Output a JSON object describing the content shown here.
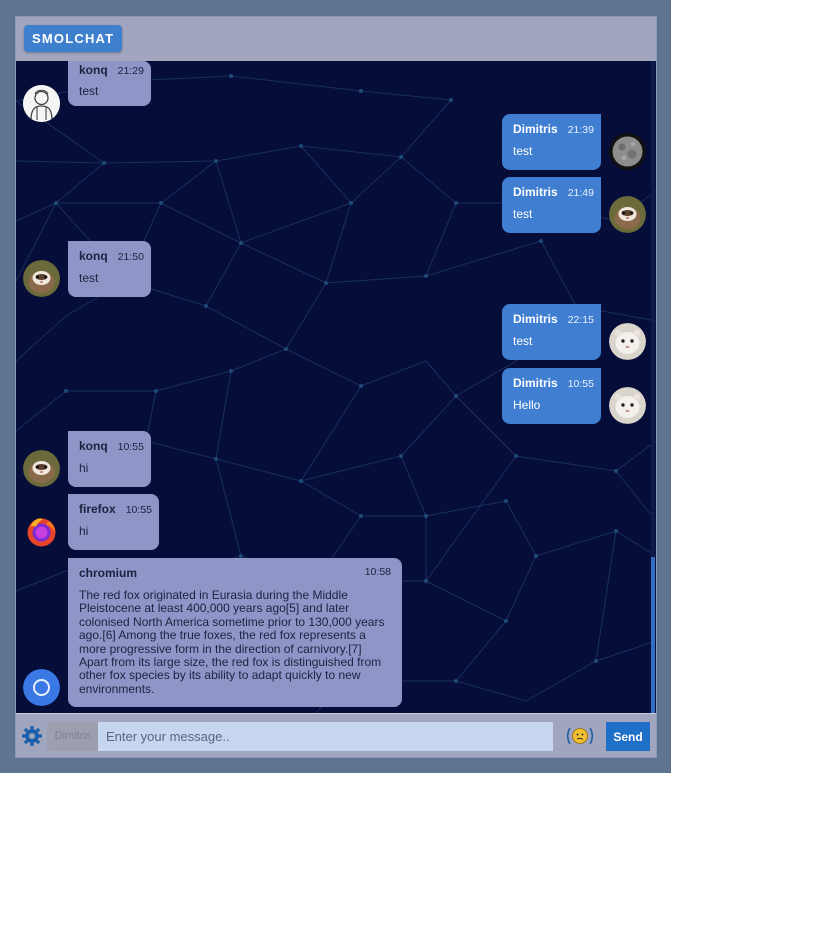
{
  "app": {
    "brand": "SMOLCHAT"
  },
  "messages": [
    {
      "side": "left",
      "name": "konq",
      "time": "21:29",
      "text": "test",
      "avatar": "person-outline-icon"
    },
    {
      "side": "right",
      "name": "Dimitris",
      "time": "21:39",
      "text": "test",
      "avatar": "moon-icon"
    },
    {
      "side": "right",
      "name": "Dimitris",
      "time": "21:49",
      "text": "test",
      "avatar": "ferret-photo-icon"
    },
    {
      "side": "left",
      "name": "konq",
      "time": "21:50",
      "text": "test",
      "avatar": "ferret-photo-icon"
    },
    {
      "side": "right",
      "name": "Dimitris",
      "time": "22:15",
      "text": "test",
      "avatar": "white-ferret-icon"
    },
    {
      "side": "right",
      "name": "Dimitris",
      "time": "10:55",
      "text": "Hello",
      "avatar": "white-ferret-icon"
    },
    {
      "side": "left",
      "name": "konq",
      "time": "10:55",
      "text": "hi",
      "avatar": "ferret-photo-icon"
    },
    {
      "side": "left",
      "name": "firefox",
      "time": "10:55",
      "text": "hi",
      "avatar": "firefox-icon"
    },
    {
      "side": "left",
      "name": "chromium",
      "time": "10:58",
      "text": "The red fox originated in Eurasia during the Middle Pleistocene at least 400,000 years ago[5] and later colonised North America sometime prior to 130,000 years ago.[6] Among the true foxes, the red fox represents a more progressive form in the direction of carnivory.[7] Apart from its large size, the red fox is distinguished from other fox species by its ability to adapt quickly to new environments.",
      "avatar": "chromium-icon"
    }
  ],
  "composer": {
    "username": "Dimitris",
    "placeholder": "Enter your message..",
    "send_label": "Send"
  },
  "colors": {
    "accent": "#3e7fce",
    "left_bubble": "#8f95c6",
    "right_bubble": "#3f7ed0",
    "background": "#060d38",
    "send": "#1d6fc8"
  }
}
